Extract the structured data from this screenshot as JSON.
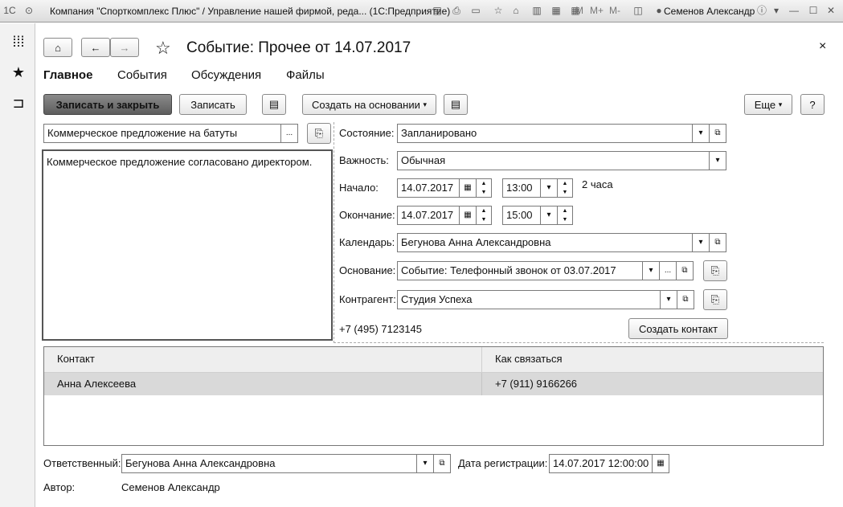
{
  "window": {
    "title": "Компания \"Спорткомплекс Плюс\" / Управление нашей фирмой, реда...  (1С:Предприятие)",
    "user": "Семенов Александр",
    "toolbar_letters": [
      "M",
      "M+",
      "M-"
    ]
  },
  "form": {
    "title": "Событие: Прочее от 14.07.2017",
    "tabs": [
      "Главное",
      "События",
      "Обсуждения",
      "Файлы"
    ]
  },
  "toolbar": {
    "save_close": "Записать и закрыть",
    "save": "Записать",
    "create_based": "Создать на основании",
    "more": "Еще",
    "help": "?"
  },
  "subject": {
    "value": "Коммерческое предложение на батуты",
    "ellipsis": "..."
  },
  "memo": "Коммерческое предложение согласовано директором.",
  "fields": {
    "state": {
      "label": "Состояние:",
      "value": "Запланировано"
    },
    "importance": {
      "label": "Важность:",
      "value": "Обычная"
    },
    "start": {
      "label": "Начало:",
      "date": "14.07.2017",
      "time": "13:00",
      "duration": "2 часа"
    },
    "end": {
      "label": "Окончание:",
      "date": "14.07.2017",
      "time": "15:00"
    },
    "calendar": {
      "label": "Календарь:",
      "value": "Бегунова Анна Александровна"
    },
    "basis": {
      "label": "Основание:",
      "value": "Событие: Телефонный звонок от 03.07.2017"
    },
    "counterparty": {
      "label": "Контрагент:",
      "value": "Студия Успеха"
    },
    "phone": "+7 (495) 7123145",
    "create_contact": "Создать контакт"
  },
  "contacts": {
    "headers": [
      "Контакт",
      "Как связаться"
    ],
    "rows": [
      {
        "contact": "Анна Алексеева",
        "how": "+7 (911) 9166266"
      }
    ]
  },
  "footer": {
    "responsible_label": "Ответственный:",
    "responsible": "Бегунова Анна Александровна",
    "reg_date_label": "Дата регистрации:",
    "reg_date": "14.07.2017 12:00:00",
    "author_label": "Автор:",
    "author": "Семенов Александр"
  },
  "icons": {
    "sidebar": [
      "apps-grid-icon",
      "favorites-star-icon",
      "history-icon"
    ],
    "toolbar": [
      "home-icon",
      "back-arrow-icon",
      "forward-arrow-icon",
      "favorite-star-icon",
      "close-icon"
    ]
  }
}
